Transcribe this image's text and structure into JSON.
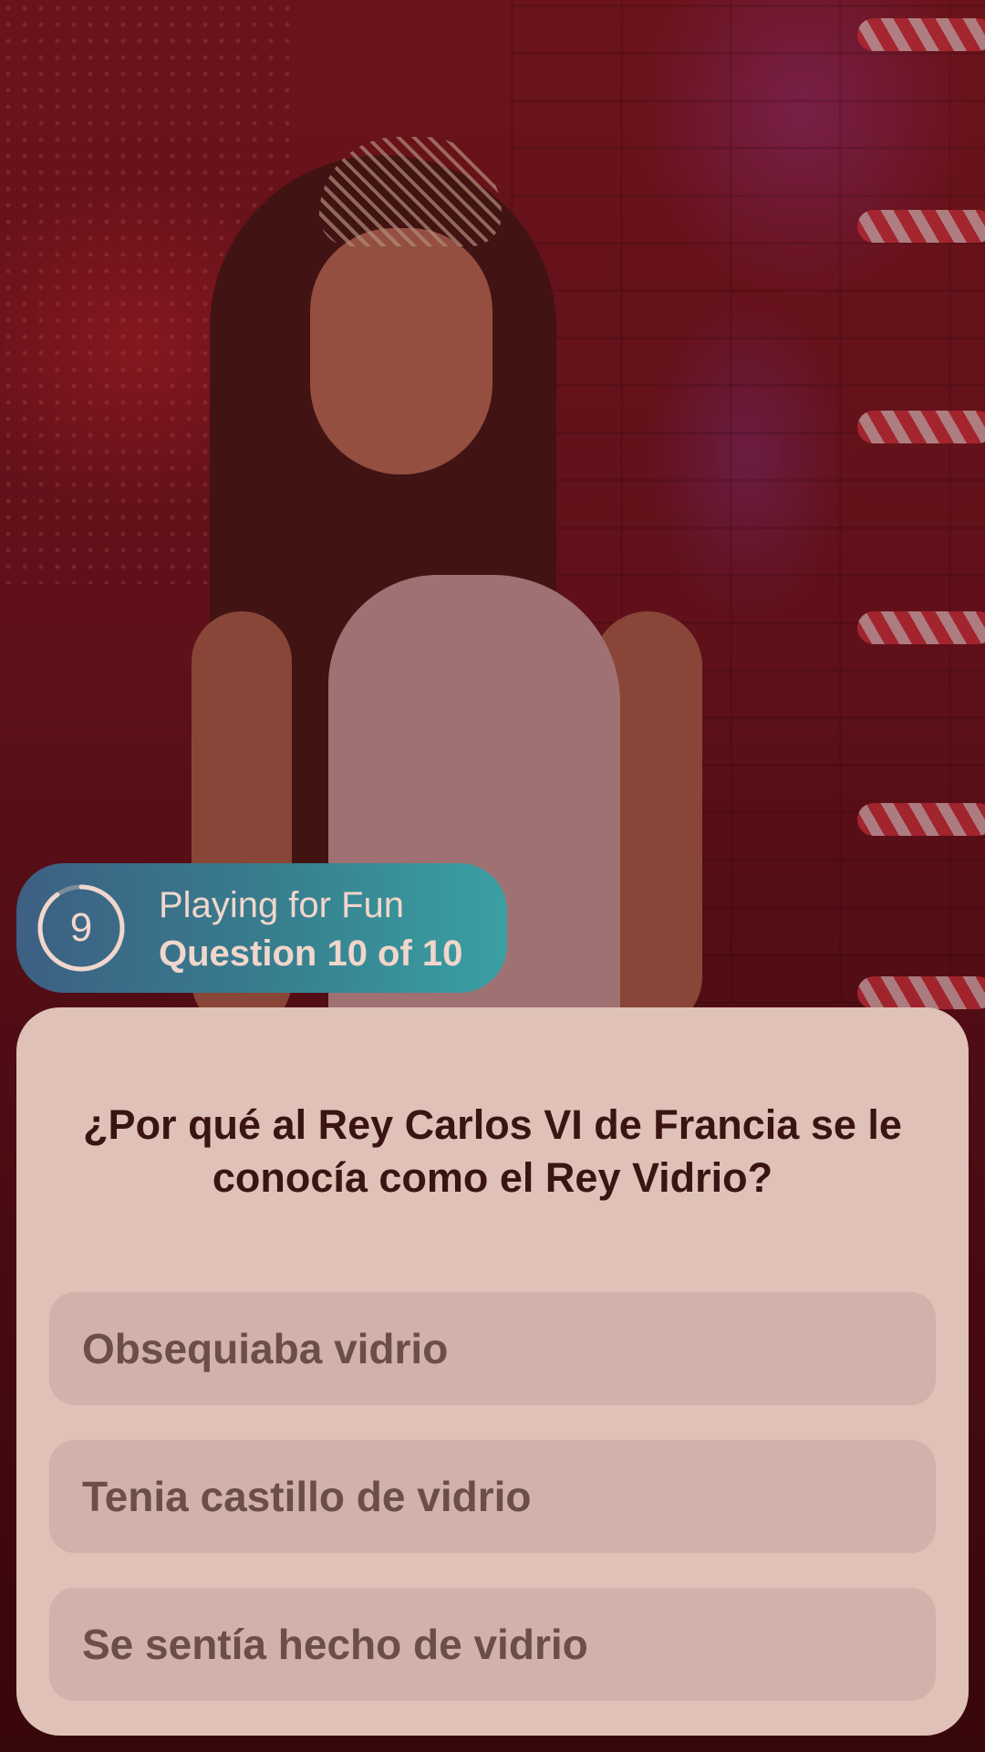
{
  "status": {
    "timer_seconds": "9",
    "timer_remaining_fraction": 0.9,
    "mode_label": "Playing for Fun",
    "progress_label": "Question 10 of 10"
  },
  "question": {
    "text": "¿Por qué al Rey Carlos VI de Francia se le conocía como el Rey Vidrio?",
    "answers": [
      "Obsequiaba vidrio",
      "Tenia castillo de vidrio",
      "Se sentía hecho de vidrio"
    ]
  },
  "colors": {
    "pill_gradient_start": "#3d5f83",
    "pill_gradient_end": "#3aa0a3",
    "card_background": "#dfc1b8",
    "answer_background": "#d1b1aa",
    "question_text": "#3a1412",
    "answer_text": "#6b4d49"
  }
}
